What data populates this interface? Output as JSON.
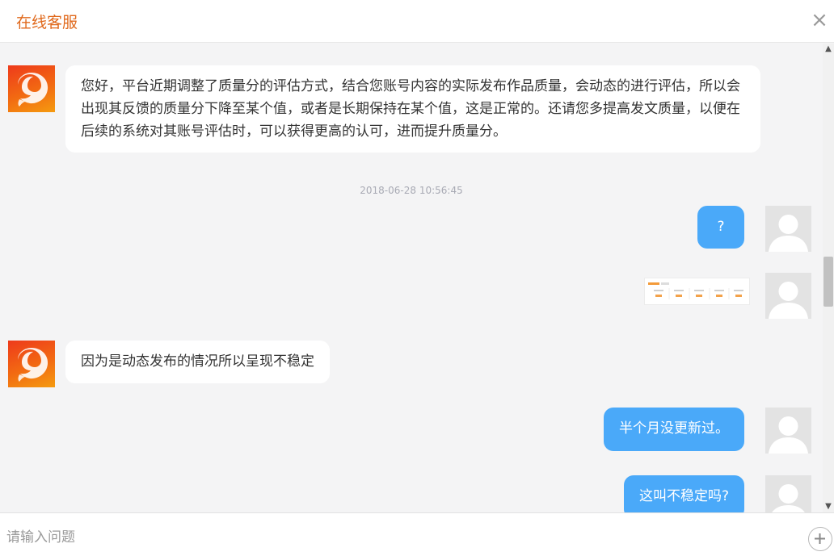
{
  "header": {
    "title": "在线客服",
    "close_icon": "close-icon"
  },
  "messages": [
    {
      "from": "service",
      "text": "您好，平台近期调整了质量分的评估方式，结合您账号内容的实际发布作品质量，会动态的进行评估，所以会出现其反馈的质量分下降至某个值，或者是长期保持在某个值，这是正常的。还请您多提高发文质量，以便在后续的系统对其账号评估时，可以获得更高的认可，进而提升质量分。"
    },
    {
      "from": "system",
      "text": "2018-06-28 10:56:45"
    },
    {
      "from": "user",
      "text": "?"
    },
    {
      "from": "user",
      "image": "screenshot-thumbnail"
    },
    {
      "from": "service",
      "text": "因为是动态发布的情况所以呈现不稳定"
    },
    {
      "from": "user",
      "text": "半个月没更新过。"
    },
    {
      "from": "user",
      "text": "这叫不稳定吗?"
    }
  ],
  "composer": {
    "placeholder": "请输入问题",
    "add_icon": "plus-icon"
  },
  "colors": {
    "accent": "#e0691c",
    "user_bubble": "#4aa9f9",
    "service_bubble": "#ffffff",
    "background": "#f4f4f5"
  }
}
